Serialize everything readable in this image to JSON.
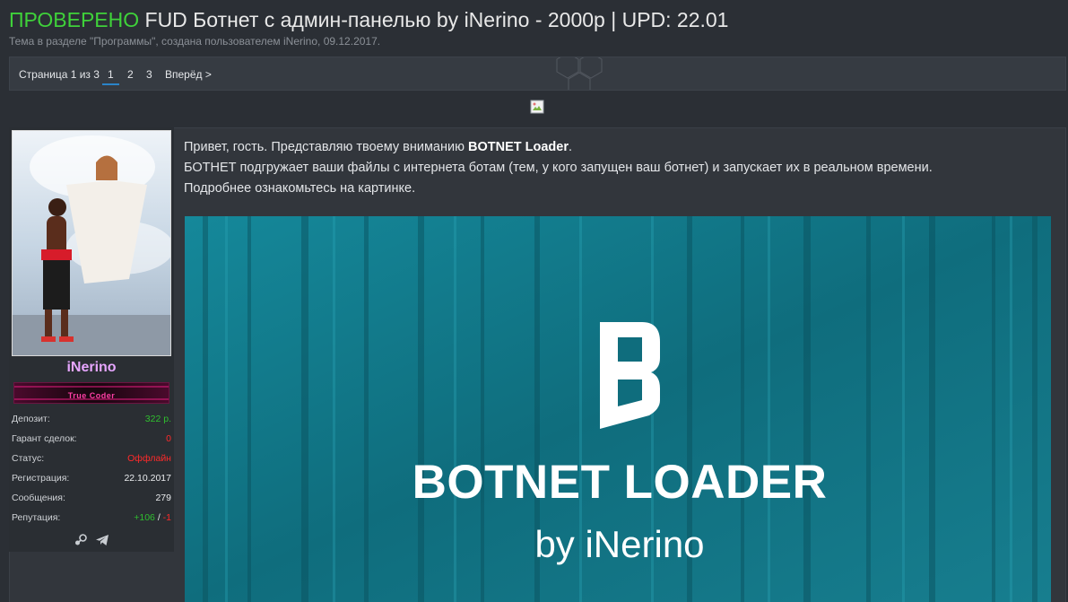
{
  "thread": {
    "title_prefix": "ПРОВЕРЕНО",
    "title": "FUD Ботнет с админ-панелью by iNerino - 2000р | UPD: 22.01",
    "subtitle": "Тема в разделе \"Программы\", создана пользователем iNerino, 09.12.2017."
  },
  "pagination": {
    "label": "Страница 1 из 3",
    "pages": [
      "1",
      "2",
      "3"
    ],
    "active_page": "1",
    "next_label": "Вперёд >"
  },
  "user": {
    "name": "iNerino",
    "userbar_text": "True Coder",
    "stats": [
      {
        "key": "Депозит:",
        "value": "322 р.",
        "color": "#2fbf2f"
      },
      {
        "key": "Гарант сделок:",
        "value": "0",
        "color": "#ff2a2a"
      },
      {
        "key": "Статус:",
        "value": "Оффлайн",
        "color": "#ff2a2a"
      },
      {
        "key": "Регистрация:",
        "value": "22.10.2017",
        "color": "#e9ebee"
      },
      {
        "key": "Сообщения:",
        "value": "279",
        "color": "#e9ebee"
      },
      {
        "key": "Репутация:",
        "value_pos": "+106",
        "value_sep": "/",
        "value_neg": "-1"
      }
    ],
    "contacts": [
      "steam-icon",
      "telegram-icon"
    ]
  },
  "post": {
    "line1_before": "Привет, гость. Представляю твоему вниманию ",
    "line1_bold": "BOTNET Loader",
    "line1_after": ".",
    "line2": "БОТНЕТ подгружает ваши файлы с интернета ботам (тем, у кого запущен ваш ботнет) и запускает их в реальном времени.",
    "line3": "Подробнее ознакомьтесь на картинке.",
    "image": {
      "logo_letter": "B",
      "headline": "BOTNET LOADER",
      "byline": "by iNerino",
      "background_color": "#0f6a7a"
    }
  },
  "colors": {
    "prefix_green": "#3fd13a",
    "username_pink": "#e7a6ff",
    "accent_blue": "#2a84c8"
  }
}
